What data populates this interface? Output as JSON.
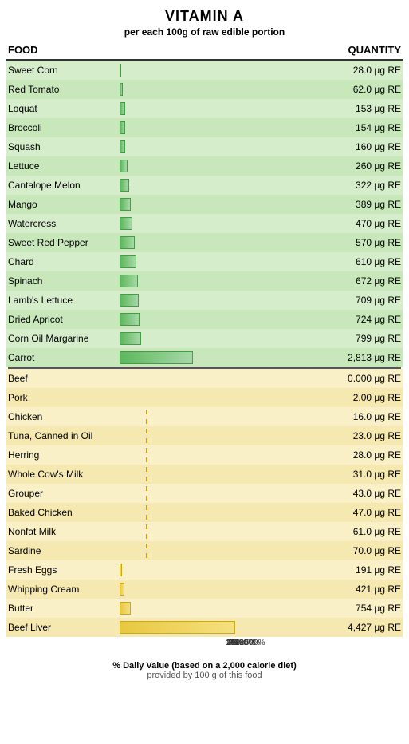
{
  "title": "VITAMIN A",
  "subtitle_pre": "per each ",
  "subtitle_bold": "100g",
  "subtitle_post": " of raw edible portion",
  "header_food": "FOOD",
  "header_quantity": "QUANTITY",
  "footer_line1_pre": "% Daily Value (based on a ",
  "footer_line1_bold": "2,000 calorie diet",
  "footer_line1_post": ")",
  "footer_line2": "provided by 100 g of this food",
  "green_items": [
    {
      "name": "Sweet Corn",
      "value": "28.0",
      "unit": "μg RE",
      "bar_pct": 0.95
    },
    {
      "name": "Red Tomato",
      "value": "62.0",
      "unit": "μg RE",
      "bar_pct": 1.5
    },
    {
      "name": "Loquat",
      "value": "153",
      "unit": "μg RE",
      "bar_pct": 2.5
    },
    {
      "name": "Broccoli",
      "value": "154",
      "unit": "μg RE",
      "bar_pct": 2.55
    },
    {
      "name": "Squash",
      "value": "160",
      "unit": "μg RE",
      "bar_pct": 2.65
    },
    {
      "name": "Lettuce",
      "value": "260",
      "unit": "μg RE",
      "bar_pct": 3.8
    },
    {
      "name": "Cantalope Melon",
      "value": "322",
      "unit": "μg RE",
      "bar_pct": 4.5
    },
    {
      "name": "Mango",
      "value": "389",
      "unit": "μg RE",
      "bar_pct": 5.3
    },
    {
      "name": "Watercress",
      "value": "470",
      "unit": "μg RE",
      "bar_pct": 6.2
    },
    {
      "name": "Sweet Red Pepper",
      "value": "570",
      "unit": "μg RE",
      "bar_pct": 7.4
    },
    {
      "name": "Chard",
      "value": "610",
      "unit": "μg RE",
      "bar_pct": 7.9
    },
    {
      "name": "Spinach",
      "value": "672",
      "unit": "μg RE",
      "bar_pct": 8.6
    },
    {
      "name": "Lamb's Lettuce",
      "value": "709",
      "unit": "μg RE",
      "bar_pct": 9.1
    },
    {
      "name": "Dried Apricot",
      "value": "724",
      "unit": "μg RE",
      "bar_pct": 9.4
    },
    {
      "name": "Corn Oil Margarine",
      "value": "799",
      "unit": "μg RE",
      "bar_pct": 10.2
    },
    {
      "name": "Carrot",
      "value": "2,813",
      "unit": "μg RE",
      "bar_pct": 35.0
    }
  ],
  "yellow_items": [
    {
      "name": "Beef",
      "value": "0.000",
      "unit": "μg RE",
      "bar_pct": 0,
      "dashed": false
    },
    {
      "name": "Pork",
      "value": "2.00",
      "unit": "μg RE",
      "bar_pct": 0,
      "dashed": false
    },
    {
      "name": "Chicken",
      "value": "16.0",
      "unit": "μg RE",
      "bar_pct": 0,
      "dashed": true
    },
    {
      "name": "Tuna, Canned in Oil",
      "value": "23.0",
      "unit": "μg RE",
      "bar_pct": 0,
      "dashed": true
    },
    {
      "name": "Herring",
      "value": "28.0",
      "unit": "μg RE",
      "bar_pct": 0,
      "dashed": true
    },
    {
      "name": "Whole Cow's Milk",
      "value": "31.0",
      "unit": "μg RE",
      "bar_pct": 0,
      "dashed": true
    },
    {
      "name": "Grouper",
      "value": "43.0",
      "unit": "μg RE",
      "bar_pct": 0,
      "dashed": true
    },
    {
      "name": "Baked Chicken",
      "value": "47.0",
      "unit": "μg RE",
      "bar_pct": 0,
      "dashed": true
    },
    {
      "name": "Nonfat Milk",
      "value": "61.0",
      "unit": "μg RE",
      "bar_pct": 0,
      "dashed": true
    },
    {
      "name": "Sardine",
      "value": "70.0",
      "unit": "μg RE",
      "bar_pct": 0,
      "dashed": true
    },
    {
      "name": "Fresh Eggs",
      "value": "191",
      "unit": "μg RE",
      "bar_pct": 1.0,
      "dashed": false
    },
    {
      "name": "Whipping Cream",
      "value": "421",
      "unit": "μg RE",
      "bar_pct": 2.2,
      "dashed": false
    },
    {
      "name": "Butter",
      "value": "754",
      "unit": "μg RE",
      "bar_pct": 5.5,
      "dashed": false
    },
    {
      "name": "Beef Liver",
      "value": "4,427",
      "unit": "μg RE",
      "bar_pct": 55.0,
      "dashed": false
    }
  ],
  "axis_labels": [
    "1%",
    "2%",
    "4%",
    "10%",
    "20%",
    "40%",
    "100%",
    "200%",
    "500%"
  ],
  "axis_positions": [
    0.5,
    3.5,
    7.0,
    12.5,
    19.0,
    28.5,
    52.5,
    70.5,
    90.0
  ]
}
